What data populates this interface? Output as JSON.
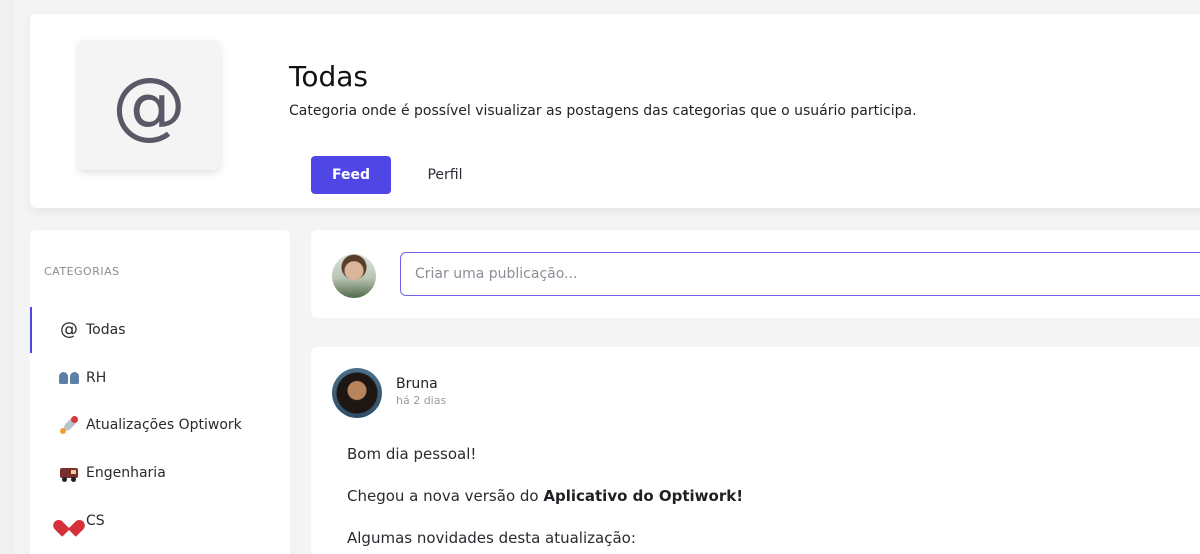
{
  "category": {
    "icon": "at-icon",
    "title": "Todas",
    "description": "Categoria onde é possível visualizar as postagens das categorias que o usuário participa.",
    "tabs": [
      {
        "label": "Feed",
        "active": true
      },
      {
        "label": "Perfil",
        "active": false
      }
    ]
  },
  "sidebar": {
    "heading": "CATEGORIAS",
    "items": [
      {
        "icon": "at-icon",
        "label": "Todas",
        "active": true
      },
      {
        "icon": "people-icon",
        "label": "RH"
      },
      {
        "icon": "rocket-icon",
        "label": "Atualizações Optiwork"
      },
      {
        "icon": "train-icon",
        "label": "Engenharia"
      },
      {
        "icon": "heart-icon",
        "label": "CS"
      }
    ]
  },
  "composer": {
    "placeholder": "Criar uma publicação..."
  },
  "post": {
    "author": "Bruna",
    "time": "há 2 dias",
    "line1": "Bom dia pessoal!",
    "line2_prefix": "Chegou a nova versão do ",
    "line2_bold": "Aplicativo do Optiwork!",
    "line3": "Algumas novidades desta atualização:"
  },
  "colors": {
    "accent": "#5046e5",
    "background": "#f4f4f5"
  }
}
